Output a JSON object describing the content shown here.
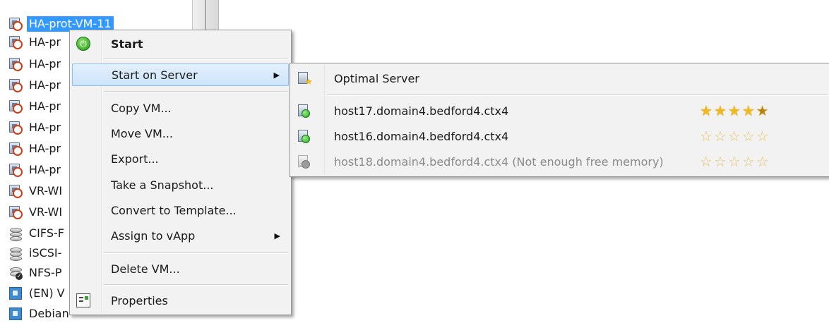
{
  "tree": {
    "items": [
      {
        "label": "HA-prot-VM-11",
        "icon": "vm-stopped-icon",
        "selected": true
      },
      {
        "label": "HA-pr",
        "icon": "vm-stopped-icon"
      },
      {
        "label": "HA-pr",
        "icon": "vm-stopped-icon"
      },
      {
        "label": "HA-pr",
        "icon": "vm-stopped-icon"
      },
      {
        "label": "HA-pr",
        "icon": "vm-stopped-icon"
      },
      {
        "label": "HA-pr",
        "icon": "vm-stopped-icon"
      },
      {
        "label": "HA-pr",
        "icon": "vm-stopped-icon"
      },
      {
        "label": "HA-pr",
        "icon": "vm-stopped-icon"
      },
      {
        "label": "VR-WI",
        "icon": "vm-stopped-icon"
      },
      {
        "label": "VR-WI",
        "icon": "vm-stopped-icon"
      },
      {
        "label": "CIFS-F",
        "icon": "storage-icon"
      },
      {
        "label": "iSCSI-",
        "icon": "storage-icon"
      },
      {
        "label": "NFS-P",
        "icon": "storage-default-icon"
      },
      {
        "label": "(EN) V",
        "icon": "template-icon"
      },
      {
        "label": "Debian",
        "icon": "template-icon"
      }
    ]
  },
  "context_menu": {
    "start": "Start",
    "start_on_server": "Start on Server",
    "copy_vm": "Copy VM...",
    "move_vm": "Move VM...",
    "export": "Export...",
    "take_snapshot": "Take a Snapshot...",
    "convert_to_template": "Convert to Template...",
    "assign_to_vapp": "Assign to vApp",
    "delete_vm": "Delete VM...",
    "properties": "Properties",
    "submenu_arrow": "▶"
  },
  "submenu": {
    "optimal_server": "Optimal Server",
    "hosts": [
      {
        "name": "host17.domain4.bedford4.ctx4",
        "rating": 4.5,
        "enabled": true
      },
      {
        "name": "host16.domain4.bedford4.ctx4",
        "rating": 0,
        "enabled": true
      },
      {
        "name": "host18.domain4.bedford4.ctx4 (Not enough free memory)",
        "rating": 0,
        "enabled": false
      }
    ]
  },
  "colors": {
    "selection": "#3399ff",
    "menu_bg": "#f2f2f2",
    "highlight_border": "#8fbff0",
    "star": "#f2b91b",
    "stop_badge": "#d23a16",
    "power_green": "#1f9a16"
  }
}
